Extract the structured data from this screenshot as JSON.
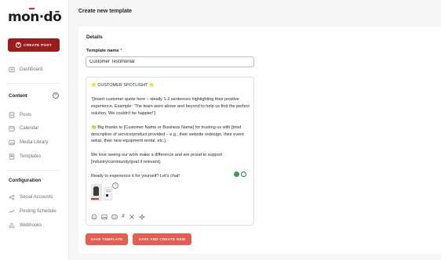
{
  "brand": {
    "logo": "mon·dō",
    "accent": "#9b1c1c",
    "primary_button": "#e85c52"
  },
  "sidebar": {
    "create_post": "CREATE POST",
    "dashboard": "Dashboard",
    "content_title": "Content",
    "content_items": [
      "Posts",
      "Calendar",
      "Media Library",
      "Templates"
    ],
    "config_title": "Configuration",
    "config_items": [
      "Social Accounts",
      "Posting Schedule",
      "Webhooks"
    ]
  },
  "page": {
    "title": "Create new template"
  },
  "details": {
    "title": "Details",
    "template_name_label": "Template name",
    "required_mark": "*",
    "template_name_value": "Customer Testimonial"
  },
  "editor": {
    "lines": [
      "🌟 CUSTOMER SPOTLIGHT 🌟",
      "\"[Insert customer quote here – ideally 1-2 sentences highlighting their positive experience. Example: 'The team went above and beyond to help us find the perfect solution. We couldn't be happier!']",
      "👏 Big thanks to [Customer Name or Business Name] for trusting us with [brief description of service/product provided – e.g., their website redesign, their event setup, their new equipment rental, etc.].",
      "We love seeing our work make a difference and are proud to support [industry/community/goal if relevant].",
      "Ready to experience it for yourself? Let's chat!"
    ],
    "toolbar_icons": [
      "emoji-icon",
      "image-icon",
      "gif-icon",
      "hashtag-icon",
      "tools-icon",
      "ai-sparkle-icon"
    ]
  },
  "actions": {
    "save_template": "SAVE TEMPLATE",
    "save_and_create_new": "SAVE AND CREATE NEW"
  }
}
